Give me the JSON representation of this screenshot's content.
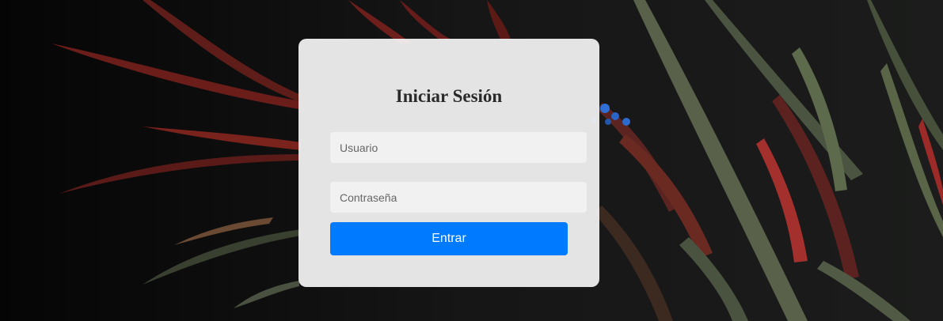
{
  "login": {
    "title": "Iniciar Sesión",
    "username": {
      "value": "",
      "placeholder": "Usuario"
    },
    "password": {
      "value": "",
      "placeholder": "Contraseña"
    },
    "submit_label": "Entrar"
  },
  "colors": {
    "accent": "#007bff",
    "card": "#f4f4f4",
    "background": "#141414"
  }
}
